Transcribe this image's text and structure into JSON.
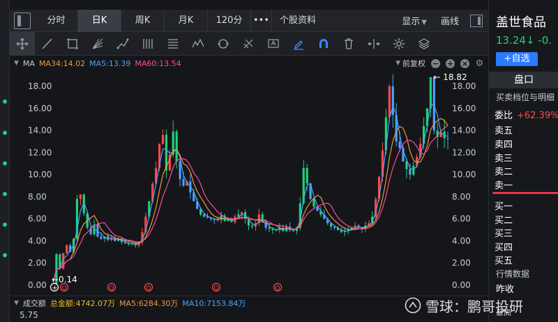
{
  "nav": {
    "tabs": [
      "分时",
      "日K",
      "周K",
      "月K",
      "120分"
    ],
    "active_tab": "日K",
    "more": "•••",
    "stock_info": "个股资料",
    "display": "显示",
    "draw": "画线"
  },
  "ma_header": {
    "name": "MA",
    "ma34": "MA34:14.02",
    "ma5": "MA5:13.39",
    "ma60": "MA60:13.54",
    "adjust": "前复权"
  },
  "volume": {
    "label": "成交额",
    "total": "总金额:4742.07万",
    "ma5": "MA5:6284.30万",
    "ma10": "MA10:7153.84万",
    "tick": "5.75"
  },
  "right_panel": {
    "name": "盖世食品",
    "price": "13.24↓ -0.",
    "add_button": "+自选",
    "tab": "盘口",
    "sub": "买卖档位与明细",
    "weibi_label": "委比",
    "weibi_value": "+62.39%",
    "asks": [
      "卖五",
      "卖四",
      "卖三",
      "卖二",
      "卖一"
    ],
    "bids": [
      "买一",
      "买二",
      "买三",
      "买四",
      "买五"
    ],
    "market_data": "行情数据",
    "prev_close": "昨收",
    "high": "最高"
  },
  "watermark": "雪球：鹏哥投研",
  "colors": {
    "up": "#ff4a4a",
    "down": "#1fd27a",
    "ma34": "#ee9a38",
    "ma5": "#4aa3ff",
    "ma60": "#ff4aa0",
    "accent": "#2a7bff"
  },
  "chart_data": {
    "type": "candlestick",
    "y_ticks": [
      "18.00",
      "16.00",
      "14.00",
      "12.00",
      "10.00",
      "8.00",
      "6.00",
      "4.00",
      "2.00",
      "0.00"
    ],
    "ylim": [
      0,
      18.82
    ],
    "annotations": {
      "max_label": "18.82",
      "min_label": "0.14"
    },
    "event_marker": "Q",
    "price_path": [
      0.14,
      2.8,
      1.5,
      2.9,
      3.6,
      3.0,
      4.2,
      7.8,
      8.2,
      6.5,
      5.2,
      4.6,
      5.5,
      4.4,
      4.2,
      4.4,
      4.1,
      4.3,
      4.0,
      4.2,
      3.9,
      3.8,
      3.7,
      3.8,
      3.6,
      3.9,
      4.8,
      6.2,
      7.6,
      9.2,
      10.6,
      12.8,
      13.6,
      10.4,
      11.8,
      13.9,
      11.2,
      9.6,
      9.0,
      9.4,
      8.4,
      7.6,
      6.9,
      6.4,
      6.2,
      6.1,
      6.0,
      5.9,
      5.9,
      6.3,
      5.8,
      6.0,
      5.7,
      6.2,
      6.4,
      6.6,
      6.0,
      5.4,
      5.3,
      5.6,
      6.4,
      5.7,
      5.2,
      5.1,
      5.0,
      5.0,
      5.2,
      4.9,
      5.3,
      5.0,
      4.9,
      5.2,
      7.4,
      10.6,
      9.2,
      7.8,
      7.1,
      6.7,
      6.4,
      6.0,
      5.6,
      5.3,
      5.2,
      5.0,
      4.8,
      4.9,
      5.0,
      5.2,
      5.4,
      5.2,
      5.1,
      5.4,
      5.6,
      6.2,
      7.8,
      9.8,
      12.2,
      15.2,
      18.0,
      15.4,
      13.0,
      12.4,
      11.2,
      10.5,
      10.0,
      10.8,
      11.6,
      12.8,
      14.4,
      16.0,
      18.82,
      14.0,
      13.4,
      13.9,
      13.3,
      13.24
    ]
  }
}
